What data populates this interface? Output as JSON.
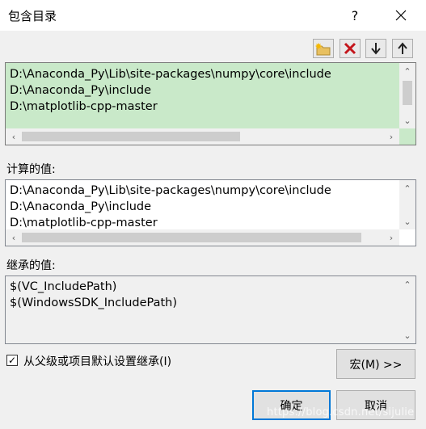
{
  "window": {
    "title": "包含目录",
    "help_label": "?"
  },
  "toolbar": {
    "buttons": [
      {
        "name": "new-line",
        "icon": "new-folder-icon"
      },
      {
        "name": "delete",
        "icon": "delete-x-icon"
      },
      {
        "name": "move-down",
        "icon": "arrow-down-icon"
      },
      {
        "name": "move-up",
        "icon": "arrow-up-icon"
      }
    ]
  },
  "editor": {
    "lines": [
      "D:\\Anaconda_Py\\Lib\\site-packages\\numpy\\core\\include",
      "D:\\Anaconda_Py\\include",
      "D:\\matplotlib-cpp-master"
    ],
    "background": "#c9e9c9"
  },
  "evaluated": {
    "label": "计算的值:",
    "lines": [
      "D:\\Anaconda_Py\\Lib\\site-packages\\numpy\\core\\include",
      "D:\\Anaconda_Py\\include",
      "D:\\matplotlib-cpp-master"
    ]
  },
  "inherited": {
    "label": "继承的值:",
    "lines": [
      "$(VC_IncludePath)",
      "$(WindowsSDK_IncludePath)"
    ]
  },
  "inherit_checkbox": {
    "label": "从父级或项目默认设置继承(I)",
    "checked": true
  },
  "buttons": {
    "macros": "宏(M) >>",
    "ok": "确定",
    "cancel": "取消"
  },
  "watermark": "https://blog.csdn.net/sijulie"
}
